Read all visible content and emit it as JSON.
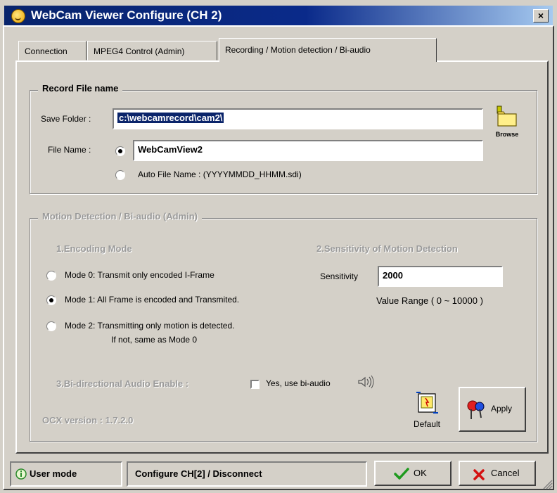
{
  "window": {
    "title": "WebCam Viewer Configure (CH 2)",
    "close_glyph": "×"
  },
  "tabs": [
    {
      "label": "Connection",
      "active": false
    },
    {
      "label": "MPEG4 Control (Admin)",
      "active": false
    },
    {
      "label": "Recording / Motion detection / Bi-audio",
      "active": true
    }
  ],
  "record": {
    "group_title": "Record File name",
    "save_folder_label": "Save Folder :",
    "save_folder_value": "c:\\webcamrecord\\cam2\\",
    "browse_label": "Browse",
    "file_name_label": "File Name :",
    "file_name_value": "WebCamView2",
    "auto_file_name_label": "Auto File Name : (YYYYMMDD_HHMM.sdi)",
    "selected": "file_name"
  },
  "motion": {
    "group_title": "Motion Detection / Bi-audio (Admin)",
    "encoding_heading": "1.Encoding Mode",
    "modes": [
      {
        "label": "Mode 0: Transmit only encoded I-Frame",
        "checked": false
      },
      {
        "label": "Mode 1: All Frame is encoded and Transmited.",
        "checked": true
      },
      {
        "label": "Mode 2: Transmitting only motion is detected.",
        "sublabel": "If not, same as Mode 0",
        "checked": false
      }
    ],
    "sensitivity_heading": "2.Sensitivity of Motion Detection",
    "sensitivity_label": "Sensitivity",
    "sensitivity_value": "2000",
    "value_range": "Value Range ( 0 ~ 10000 )",
    "biaudio_heading": "3.Bi-directional Audio Enable :",
    "biaudio_checkbox_label": "Yes, use bi-audio",
    "biaudio_checked": false,
    "ocx_version": "OCX version : 1.7.2.0",
    "default_label": "Default",
    "apply_label": "Apply"
  },
  "statusbar": {
    "user_mode": "User mode",
    "status_text": "Configure CH[2] / Disconnect",
    "ok_label": "OK",
    "cancel_label": "Cancel"
  },
  "colors": {
    "titlebar_start": "#08246b",
    "titlebar_end": "#a6caf0",
    "dialog_bg": "#d4d0c8",
    "selection": "#0a246a",
    "ok_green": "#1e9a1e",
    "cancel_red": "#d41010"
  }
}
